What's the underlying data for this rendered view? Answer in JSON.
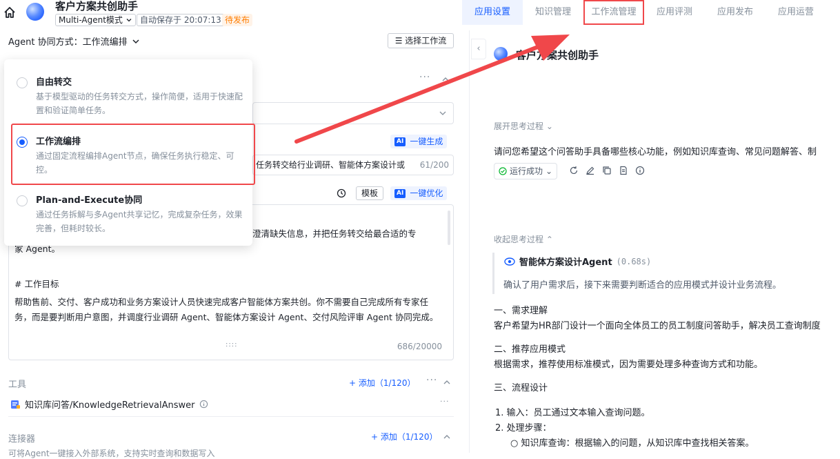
{
  "app": {
    "title": "客户方案共创助手",
    "mode": "Multi-Agent模式",
    "autosave": "自动保存于 20:07:13",
    "status": "待发布"
  },
  "tabs": [
    "应用设置",
    "知识管理",
    "工作流管理",
    "应用评测",
    "应用发布",
    "应用运营"
  ],
  "left": {
    "coop_label": "Agent 协同方式：工作流编排",
    "choose_workflow": "选择工作流",
    "ai_generate": "一键生成",
    "ai_optimize": "一键优化",
    "ai_badge": "AI",
    "desc_value": "任务转交给行业调研、智能体方案设计或",
    "desc_count": "61/200",
    "template": "模板",
    "prompt_lines": [
      "求、澄清缺失信息，并把任务转交给最合适的专",
      "家 Agent。",
      "# 工作目标",
      "帮助售前、交付、客户成功和业务方案设计人员快速完成客户智能体方案共创。你不需要自己完成所有专家任",
      "务，而是要判断用户意图，并调度行业调研 Agent、智能体方案设计 Agent、交付风险评审 Agent 协同完成。"
    ],
    "prompt_count": "686/20000",
    "tools_label": "工具",
    "tools_add": "+ 添加（1/120）",
    "tool_name": "知识库问答/KnowledgeRetrievalAnswer",
    "connector_label": "连接器",
    "connector_add": "+ 添加（1/120）",
    "connector_desc": "可将Agent一键接入外部系统，支持实时查询和数据写入"
  },
  "popover": {
    "options": [
      {
        "title": "自由转交",
        "desc": "基于模型驱动的任务转交方式，操作简便，适用于快速配置和验证简单任务。",
        "selected": false
      },
      {
        "title": "工作流编排",
        "desc": "通过固定流程编排Agent节点，确保任务执行稳定、可控。",
        "selected": true
      },
      {
        "title": "Plan-and-Execute协同",
        "desc": "通过任务拆解与多Agent共享记忆，完成复杂任务，效果完善，但耗时较长。",
        "selected": false
      }
    ]
  },
  "preview": {
    "title": "客户方案共创助手",
    "expand_thinking": "展开思考过程",
    "question": "请问您希望这个问答助手具备哪些核心功能，例如知识库查询、常见问题解答、制",
    "run_status": "运行成功",
    "collapse_thinking": "收起思考过程",
    "agent_name": "智能体方案设计Agent",
    "agent_time": "(0.68s)",
    "agent_desc": "确认了用户需求后，接下来需要判断适合的应用模式并设计业务流程。",
    "s1_title": "一、需求理解",
    "s1_text": "客户希望为HR部门设计一个面向全体员工的员工制度问答助手，解决员工查询制度",
    "s2_title": "二、推荐应用模式",
    "s2_text": "根据需求，推荐使用标准模式，因为需要处理多种查询方式和功能。",
    "s3_title": "三、流程设计",
    "step1": "1.  输入：员工通过文本输入查询问题。",
    "step2": "2.  处理步骤：",
    "bullet1": "知识库查询：根据输入的问题，从知识库中查找相关答案。"
  },
  "colors": {
    "accent": "#165dff",
    "highlight": "#f0474a",
    "pending": "#ff7d00"
  }
}
